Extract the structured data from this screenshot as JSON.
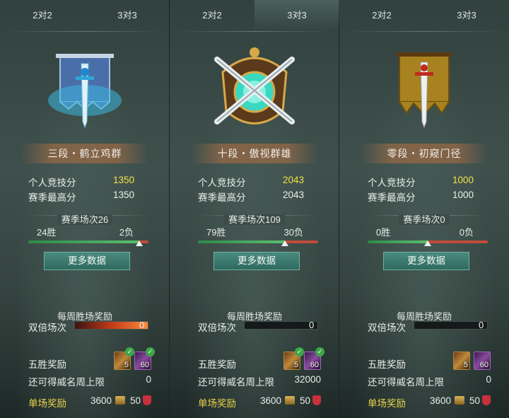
{
  "panels": [
    {
      "tabs": [
        "2对2",
        "3对3"
      ],
      "active_tab": 0,
      "rank": "三段・鹤立鸡群",
      "emblem_icon": "blue-banner-sword-icon",
      "personal_label": "个人竞技分",
      "personal_value": "1350",
      "season_high_label": "赛季最高分",
      "season_high_value": "1350",
      "season_games": "赛季场次26",
      "wins": "24胜",
      "losses": "2负",
      "win_ratio": 0.923,
      "more_label": "更多数据",
      "weekly_title": "每周胜场奖励",
      "double_label": "双倍场次",
      "double_value": "0",
      "double_fill": 1.0,
      "five_win_label": "五胜奖励",
      "item_a_count": "5",
      "item_b_count": "60",
      "cap_label": "还可得威名周上限",
      "cap_value": "0",
      "single_label": "单场奖励",
      "single_coin": "3600",
      "single_shield": "50"
    },
    {
      "tabs": [
        "2对2",
        "3对3"
      ],
      "active_tab": 1,
      "rank": "十段・傲视群雄",
      "emblem_icon": "crossed-swords-crest-icon",
      "personal_label": "个人竞技分",
      "personal_value": "2043",
      "season_high_label": "赛季最高分",
      "season_high_value": "2043",
      "season_games": "赛季场次109",
      "wins": "79胜",
      "losses": "30负",
      "win_ratio": 0.725,
      "more_label": "更多数据",
      "weekly_title": "每周胜场奖励",
      "double_label": "双倍场次",
      "double_value": "0",
      "double_fill": 0.0,
      "five_win_label": "五胜奖励",
      "item_a_count": "5",
      "item_b_count": "60",
      "cap_label": "还可得威名周上限",
      "cap_value": "32000",
      "single_label": "单场奖励",
      "single_coin": "3600",
      "single_shield": "50"
    },
    {
      "tabs": [
        "2对2",
        "3对3"
      ],
      "active_tab": 1,
      "rank": "零段・初窥门径",
      "emblem_icon": "gold-banner-sword-icon",
      "personal_label": "个人竞技分",
      "personal_value": "1000",
      "season_high_label": "赛季最高分",
      "season_high_value": "1000",
      "season_games": "赛季场次0",
      "wins": "0胜",
      "losses": "0负",
      "win_ratio": 0.5,
      "more_label": "更多数据",
      "weekly_title": "每周胜场奖励",
      "double_label": "双倍场次",
      "double_value": "0",
      "double_fill": 0.0,
      "five_win_label": "五胜奖励",
      "item_a_count": "5",
      "item_b_count": "60",
      "cap_label": "还可得威名周上限",
      "cap_value": "0",
      "single_label": "单场奖励",
      "single_coin": "3600",
      "single_shield": "50"
    }
  ],
  "colors": {
    "accent_yellow": "#f4e04a",
    "win_green": "#4aae5e",
    "loss_red": "#c24a3a",
    "button_teal": "#3a7a6e"
  }
}
